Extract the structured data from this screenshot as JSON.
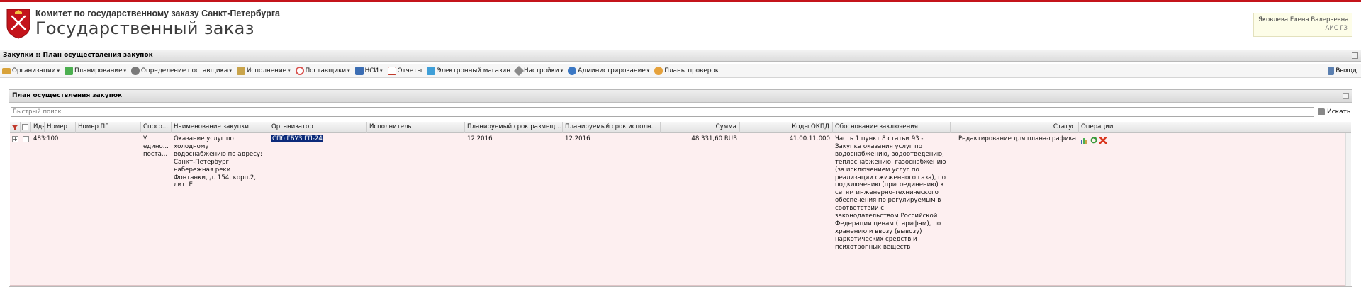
{
  "header": {
    "org_name": "Комитет по государственному заказу Санкт-Петербурга",
    "app_title": "Государственный заказ",
    "user_name": "Яковлева Елена Валерьевна",
    "user_system": "АИС ГЗ"
  },
  "pagebar": {
    "title": "Закупки :: План осуществления закупок"
  },
  "menu": {
    "items": [
      {
        "label": "Организации",
        "icon": "folder-icon",
        "dropdown": true,
        "color": "#d8a23a"
      },
      {
        "label": "Планирование",
        "icon": "planning-icon",
        "dropdown": true,
        "color": "#4caf50"
      },
      {
        "label": "Определение поставщика",
        "icon": "gear-icon",
        "dropdown": true,
        "color": "#7a7a7a"
      },
      {
        "label": "Исполнение",
        "icon": "execution-icon",
        "dropdown": true,
        "color": "#c9a44b"
      },
      {
        "label": "Поставщики",
        "icon": "clock-icon",
        "dropdown": true,
        "color": "#d9534f"
      },
      {
        "label": "НСИ",
        "icon": "book-icon",
        "dropdown": true,
        "color": "#3b6db3"
      },
      {
        "label": "Отчеты",
        "icon": "report-icon",
        "dropdown": false,
        "color": "#c0392b"
      },
      {
        "label": "Электронный магазин",
        "icon": "shop-icon",
        "dropdown": false,
        "color": "#3f9fd8"
      },
      {
        "label": "Настройки",
        "icon": "wrench-icon",
        "dropdown": true,
        "color": "#8a8a8a"
      },
      {
        "label": "Администрирование",
        "icon": "admin-user-icon",
        "dropdown": true,
        "color": "#3b78c4"
      },
      {
        "label": "Планы проверок",
        "icon": "inspector-user-icon",
        "dropdown": false,
        "color": "#e6a23c"
      }
    ],
    "exit_label": "Выход"
  },
  "panel": {
    "title": "План осуществления закупок",
    "search_placeholder": "Быстрый поиск",
    "search_button": "Искать"
  },
  "table": {
    "columns": [
      "Иде",
      "Номер",
      "Номер ПГ",
      "Спосо...",
      "Наименование закупки",
      "Организатор",
      "Исполнитель",
      "Планируемый срок размещ...",
      "Планируемый срок исполн...",
      "Сумма",
      "Коды ОКПД",
      "Обоснование заключения",
      "Статус",
      "Операции"
    ],
    "rows": [
      {
        "id": "483:",
        "number": "100",
        "pg_number": "",
        "method": "У едино... поста...",
        "name": "Оказание услуг по холодному водоснабжению по адресу: Санкт-Петербург, набережная реки Фонтанки, д. 154, корп.2, лит. Е",
        "organizer": "СПб ГБУЗ ГП-24",
        "executor": "",
        "plan_placement": "12.2016",
        "plan_execution": "12.2016",
        "sum": "48 331,60 RUB",
        "okpd": "41.00.11.000",
        "justification": "Часть 1 пункт 8 статьи 93 - Закупка оказания услуг по водоснабжению, водоотведению, теплоснабжению, газоснабжению (за исключением услуг по реализации сжиженного газа), по подключению (присоединению) к сетям инженерно-технического обеспечения по регулируемым в соответствии с законодательством Российской Федерации ценам (тарифам), по хранению и ввозу (вывозу) наркотических средств и психотропных веществ",
        "status": "Редактирование для плана-графика"
      }
    ]
  },
  "colors": {
    "brand_red": "#c4141b",
    "row_highlight": "#fdeff0",
    "selected_bg": "#0c2a7a"
  }
}
